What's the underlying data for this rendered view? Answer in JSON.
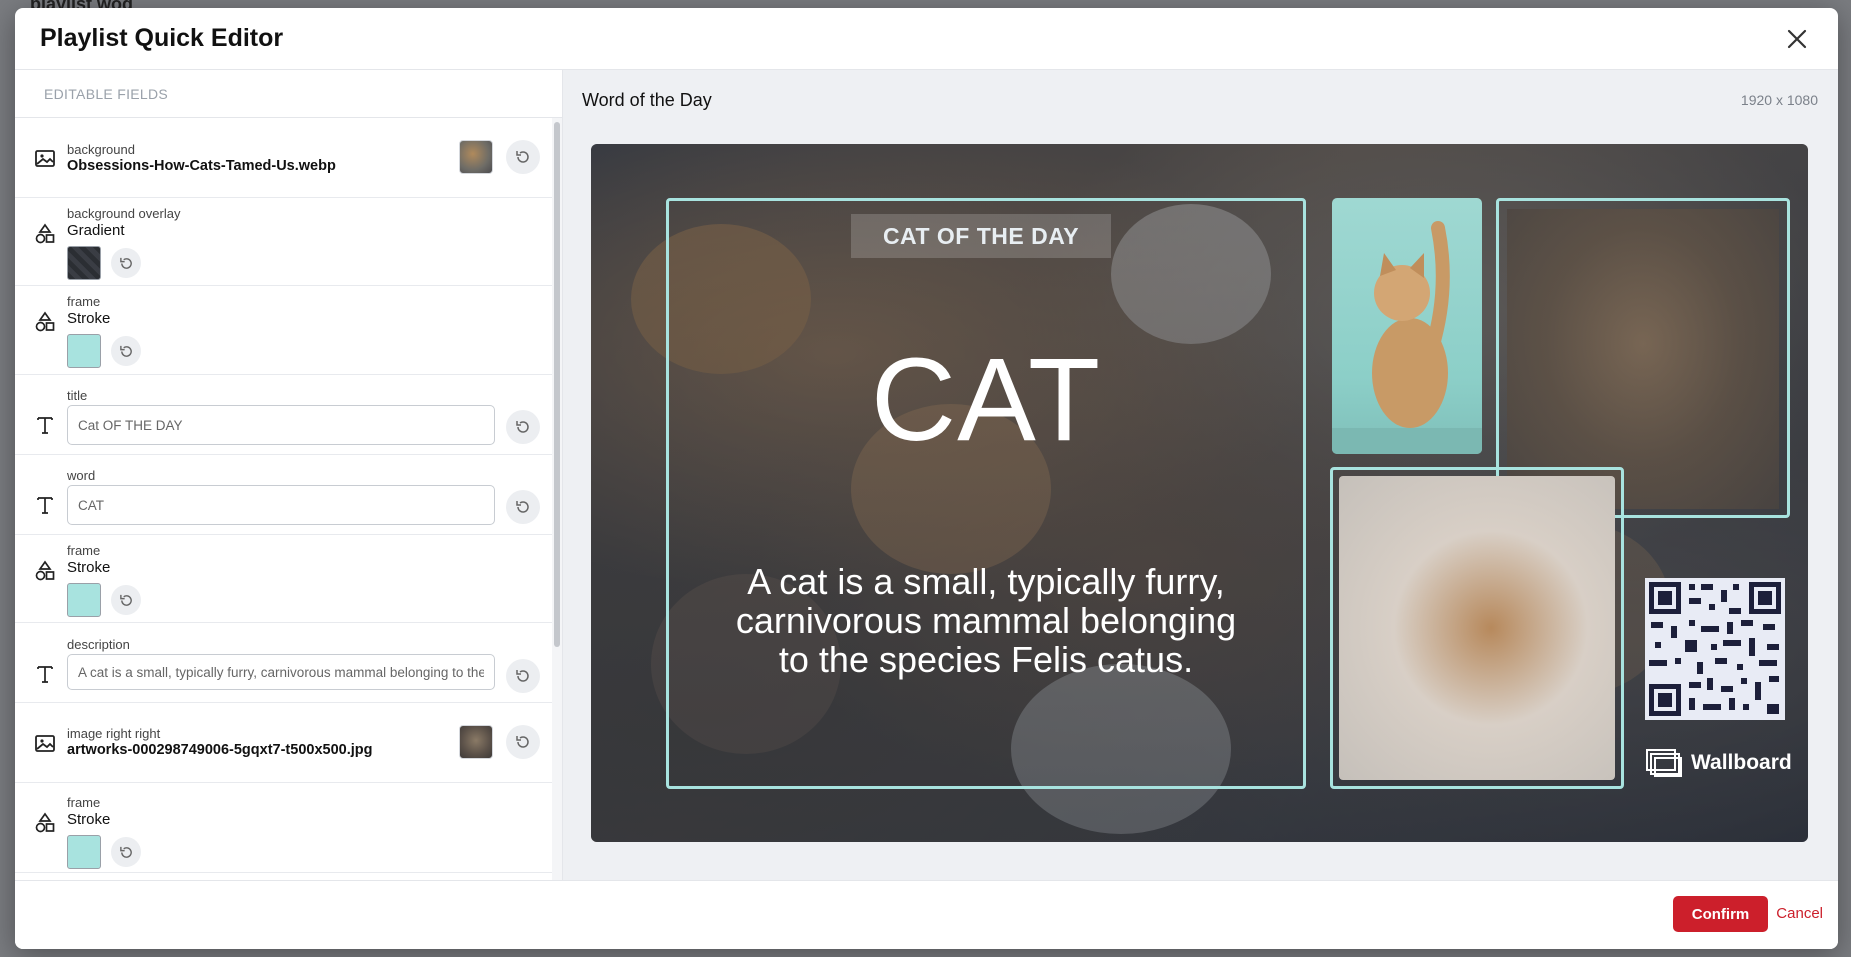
{
  "background_app": {
    "title": "playlist wod"
  },
  "modal": {
    "title": "Playlist Quick Editor"
  },
  "left_panel": {
    "heading": "EDITABLE FIELDS",
    "fields": [
      {
        "label": "background",
        "value": "Obsessions-How-Cats-Tamed-Us.webp",
        "kind": "image",
        "icon": "image-icon"
      },
      {
        "label": "background overlay",
        "value": "Gradient",
        "kind": "color",
        "icon": "shapes-icon",
        "swatch": "#2b2e33"
      },
      {
        "label": "frame",
        "value": "Stroke",
        "kind": "color",
        "icon": "shapes-icon",
        "swatch": "#a8e3df"
      },
      {
        "label": "title",
        "value": "Cat OF THE DAY",
        "kind": "text",
        "icon": "text-icon"
      },
      {
        "label": "word",
        "value": "CAT",
        "kind": "text",
        "icon": "text-icon"
      },
      {
        "label": "frame",
        "value": "Stroke",
        "kind": "color",
        "icon": "shapes-icon",
        "swatch": "#a8e3df"
      },
      {
        "label": "description",
        "value": "A cat is a small, typically furry, carnivorous mammal belonging to the species Felis catus.",
        "kind": "text",
        "icon": "text-icon"
      },
      {
        "label": "image right right",
        "value": "artworks-000298749006-5gqxt7-t500x500.jpg",
        "kind": "image",
        "icon": "image-icon"
      },
      {
        "label": "frame",
        "value": "Stroke",
        "kind": "color",
        "icon": "shapes-icon",
        "swatch": "#a8e3df"
      }
    ]
  },
  "preview": {
    "title": "Word of the Day",
    "dimensions": "1920 x 1080",
    "slide": {
      "title": "CAT OF THE DAY",
      "word": "CAT",
      "description": "A cat is a small, typically furry, carnivorous mammal belonging to the species Felis catus.",
      "brand": "Wallboard"
    }
  },
  "footer": {
    "confirm_label": "Confirm",
    "cancel_label": "Cancel"
  },
  "colors": {
    "accent_red": "#cc1f2b",
    "frame_stroke": "#a8e3df"
  }
}
